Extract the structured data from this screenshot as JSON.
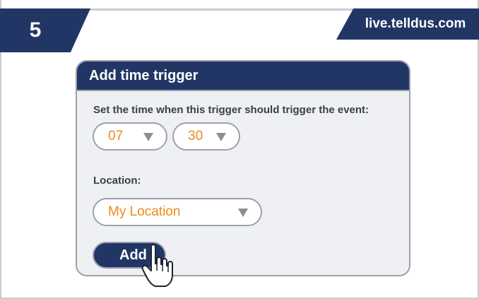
{
  "step": {
    "number": "5"
  },
  "site": {
    "url": "live.telldus.com"
  },
  "dialog": {
    "title": "Add time trigger",
    "prompt": "Set the time when this trigger should trigger the event:",
    "hour": {
      "value": "07",
      "icon": "caret-down-icon"
    },
    "minute": {
      "value": "30",
      "icon": "caret-down-icon"
    },
    "location_label": "Location:",
    "location": {
      "value": "My Location",
      "icon": "caret-down-icon"
    },
    "add_label": "Add"
  },
  "cursor": {
    "icon": "hand-pointer-icon"
  },
  "colors": {
    "navy": "#213665",
    "accent_orange": "#f08a1c",
    "panel": "#eff0f3",
    "border": "#9ca1ab"
  }
}
